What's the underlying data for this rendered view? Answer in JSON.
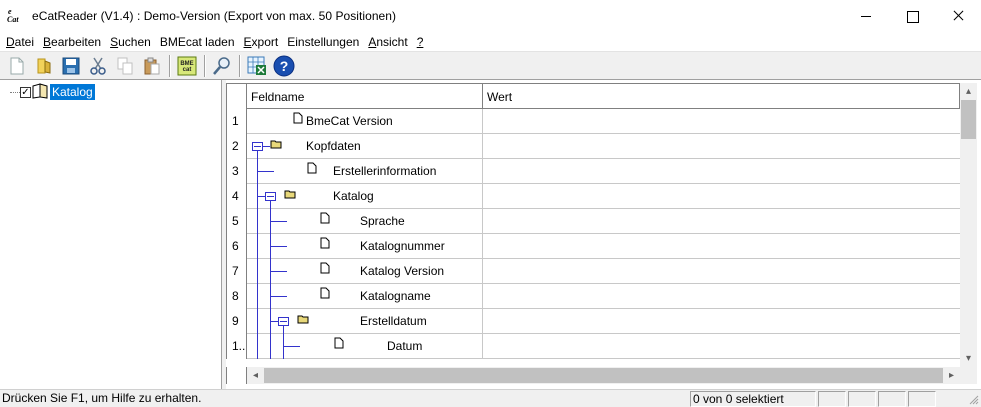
{
  "window": {
    "title": "eCatReader (V1.4) : Demo-Version (Export von max. 50 Positionen)",
    "app_icon_top": "e",
    "app_icon_bottom": "Cat"
  },
  "menubar": {
    "items": [
      {
        "accel": "D",
        "rest": "atei"
      },
      {
        "accel": "B",
        "rest": "earbeiten"
      },
      {
        "accel": "S",
        "rest": "uchen"
      },
      {
        "accel": "",
        "rest": "BMEcat laden"
      },
      {
        "accel": "E",
        "rest": "xport"
      },
      {
        "accel": "E",
        "rest": "instellungen",
        "display": "Einstellungen"
      },
      {
        "accel": "A",
        "rest": "nsicht"
      },
      {
        "accel": "?",
        "rest": ""
      }
    ]
  },
  "toolbar": {
    "buttons": [
      {
        "icon": "new-document-icon"
      },
      {
        "icon": "open-folder-icon"
      },
      {
        "icon": "save-icon"
      },
      {
        "icon": "cut-icon"
      },
      {
        "icon": "copy-icon"
      },
      {
        "icon": "paste-icon"
      },
      {
        "icon": "bmecat-icon",
        "label": "BME cat"
      },
      {
        "icon": "search-icon"
      },
      {
        "icon": "export-excel-icon"
      },
      {
        "icon": "help-icon",
        "label": "?"
      }
    ]
  },
  "tree": {
    "root_label": "Katalog",
    "checked": true,
    "check_glyph": "✓"
  },
  "grid": {
    "columns": [
      "Feldname",
      "Wert"
    ],
    "rows": [
      {
        "num": "1",
        "label": "BmeCat Version",
        "type": "leaf",
        "depth": 0
      },
      {
        "num": "2",
        "label": "Kopfdaten",
        "type": "folder",
        "depth": 0
      },
      {
        "num": "3",
        "label": "Erstellerinformation",
        "type": "leaf",
        "depth": 1
      },
      {
        "num": "4",
        "label": "Katalog",
        "type": "folder",
        "depth": 1
      },
      {
        "num": "5",
        "label": "Sprache",
        "type": "leaf",
        "depth": 2
      },
      {
        "num": "6",
        "label": "Katalognummer",
        "type": "leaf",
        "depth": 2
      },
      {
        "num": "7",
        "label": "Katalog Version",
        "type": "leaf",
        "depth": 2
      },
      {
        "num": "8",
        "label": "Katalogname",
        "type": "leaf",
        "depth": 2
      },
      {
        "num": "9",
        "label": "Erstelldatum",
        "type": "folder",
        "depth": 2
      },
      {
        "num": "1..",
        "label": "Datum",
        "type": "leaf",
        "depth": 3
      }
    ]
  },
  "statusbar": {
    "message": "Drücken Sie F1, um Hilfe zu erhalten.",
    "selection": "0 von 0 selektiert"
  },
  "colors": {
    "selection": "#0078d7",
    "tree_lines": "#3333cc",
    "chrome": "#f0f0f0"
  }
}
